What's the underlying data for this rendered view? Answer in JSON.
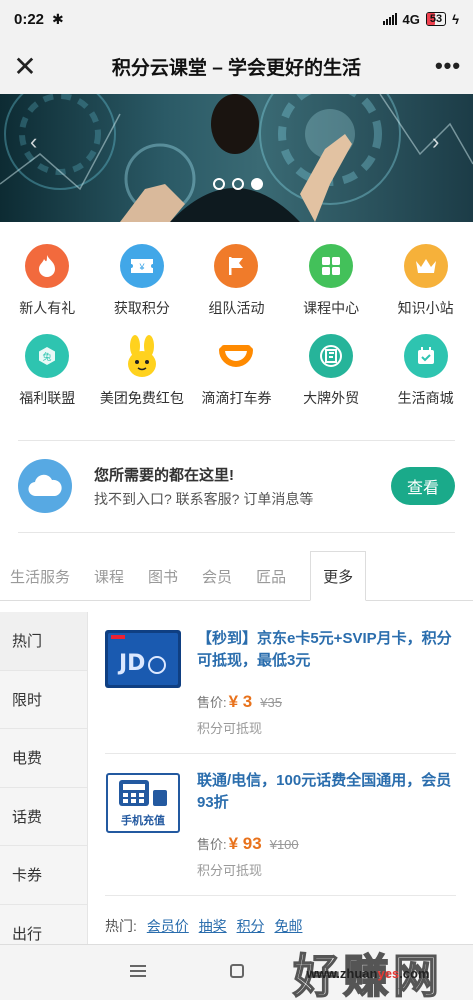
{
  "status": {
    "time": "0:22",
    "network": "4G",
    "battery": "53"
  },
  "titlebar": {
    "title": "积分云课堂 – 学会更好的生活"
  },
  "grid": [
    {
      "label": "新人有礼",
      "icon": "fire-icon",
      "color": "#f26a3d"
    },
    {
      "label": "获取积分",
      "icon": "coupon-icon",
      "color": "#41a7e8"
    },
    {
      "label": "组队活动",
      "icon": "flag-icon",
      "color": "#f07b2a"
    },
    {
      "label": "课程中心",
      "icon": "grid-icon",
      "color": "#43c15a"
    },
    {
      "label": "知识小站",
      "icon": "crown-icon",
      "color": "#f6b13a"
    },
    {
      "label": "福利联盟",
      "icon": "gift-icon",
      "color": "#2ec4b0"
    },
    {
      "label": "美团免费红包",
      "icon": "kangaroo-icon",
      "color": "#ffd21e"
    },
    {
      "label": "滴滴打车券",
      "icon": "didi-icon",
      "color": "#ff8a00"
    },
    {
      "label": "大牌外贸",
      "icon": "brand-icon",
      "color": "#26b49a"
    },
    {
      "label": "生活商城",
      "icon": "calendar-icon",
      "color": "#2ec4b0"
    }
  ],
  "service": {
    "title": "您所需要的都在这里!",
    "subtitle": "找不到入口? 联系客服? 订单消息等",
    "button": "查看"
  },
  "tabs": [
    "生活服务",
    "课程",
    "图书",
    "会员",
    "匠品",
    "更多"
  ],
  "sidebar": [
    "热门",
    "限时",
    "电费",
    "话费",
    "卡券",
    "出行"
  ],
  "products": [
    {
      "title": "【秒到】京东e卡5元+SVIP月卡，积分可抵现，最低3元",
      "price_label": "售价:",
      "price": "¥ 3",
      "old_price": "¥35",
      "note": "积分可抵现",
      "image": "jd-card-image"
    },
    {
      "title": "联通/电信，100元话费全国通用，会员93折",
      "price_label": "售价:",
      "price": "¥ 93",
      "old_price": "¥100",
      "note": "积分可抵现",
      "image": "phone-recharge-image",
      "image_text": "手机充值"
    }
  ],
  "hot": {
    "label": "热门:",
    "links": [
      "会员价",
      "抽奖",
      "积分",
      "免邮"
    ]
  },
  "watermark": {
    "text": "好赚网",
    "url_a": "www.zhuan",
    "url_b": "yes",
    "url_c": ".com"
  }
}
